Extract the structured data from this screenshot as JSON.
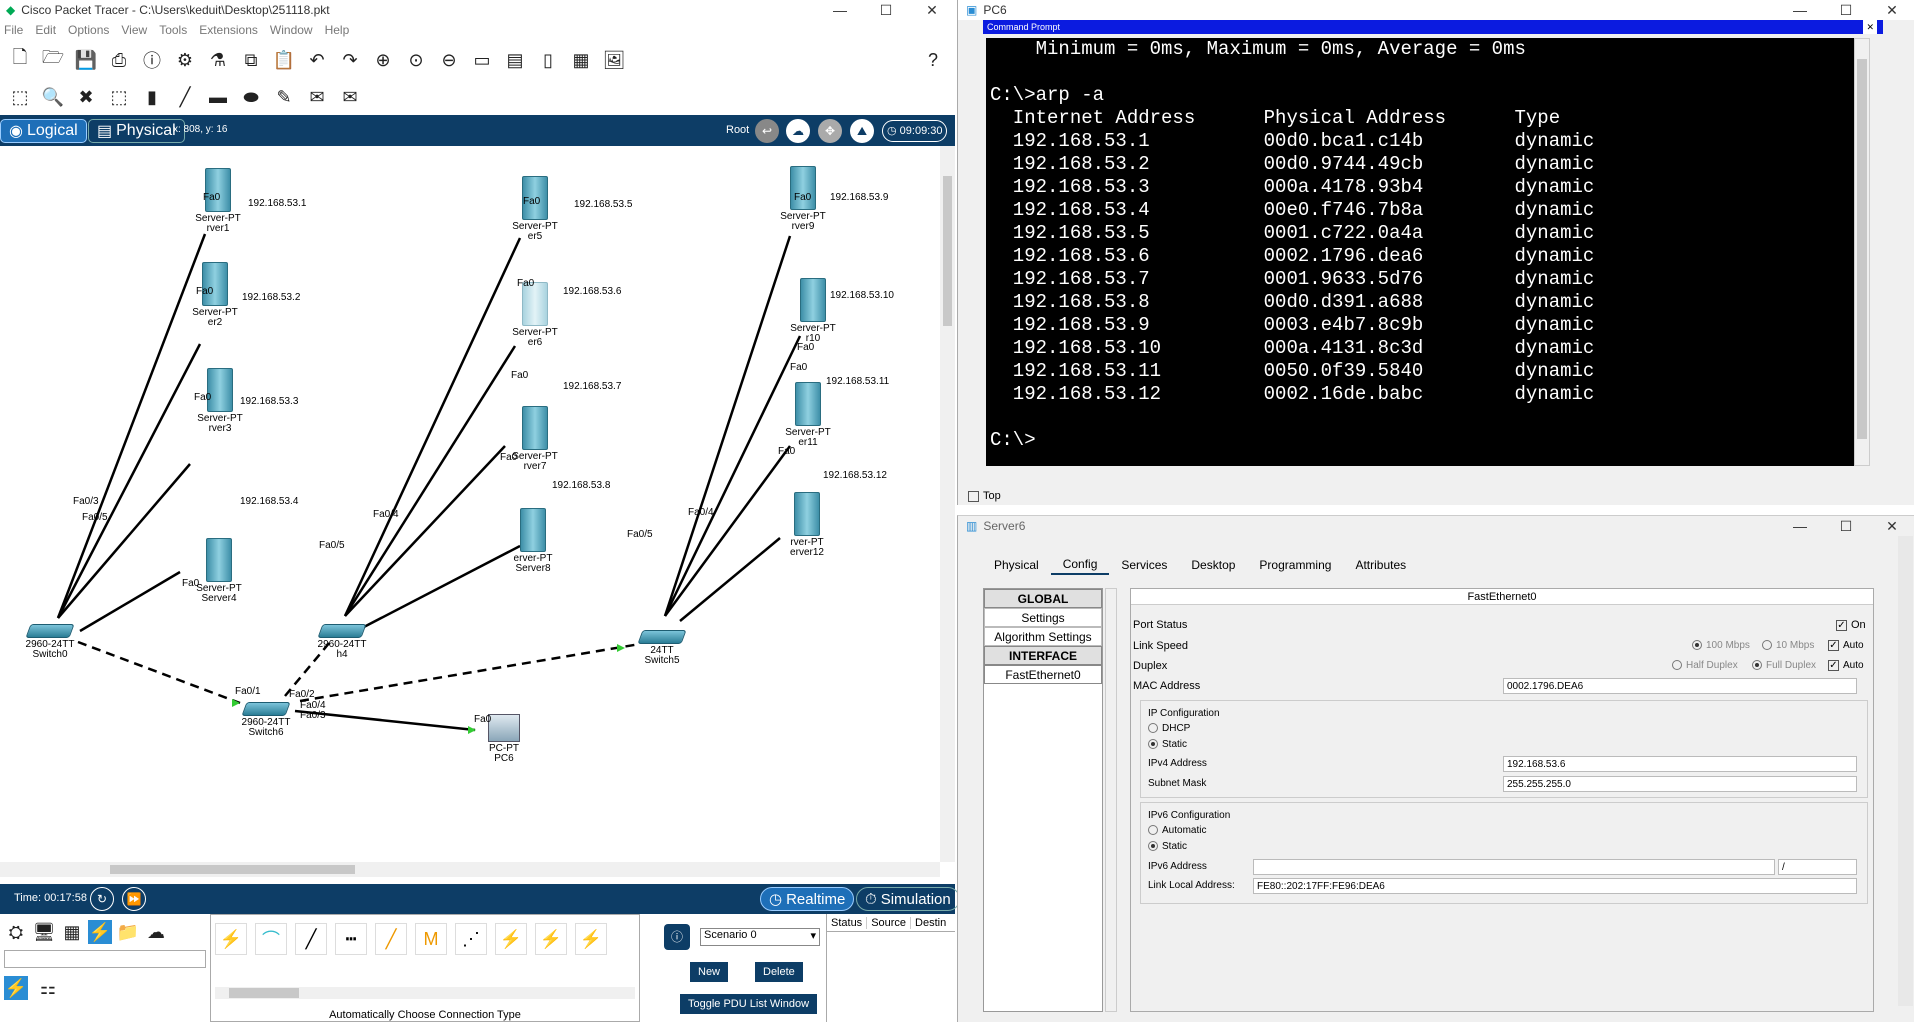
{
  "pt": {
    "title": "Cisco Packet Tracer - C:\\Users\\keduit\\Desktop\\251118.pkt",
    "menu": [
      "File",
      "Edit",
      "Options",
      "View",
      "Tools",
      "Extensions",
      "Window",
      "Help"
    ],
    "logical_label": "Logical",
    "physical_label": "Physical",
    "coords": "x: 808, y: 16",
    "root_label": "Root",
    "clock": "09:09:30",
    "time_label": "Time: 00:17:58",
    "realtime_label": "Realtime",
    "simulation_label": "Simulation",
    "scenario": "Scenario 0",
    "new_label": "New",
    "delete_label": "Delete",
    "toggle_pdu_label": "Toggle PDU List Window",
    "auto_conn_label": "Automatically Choose Connection Type",
    "pdu_cols": [
      "Status",
      "Source",
      "Destin"
    ]
  },
  "devices": {
    "server1": {
      "type": "Server-PT",
      "name": "rver1",
      "port": "Fa0",
      "ip": "192.168.53.1"
    },
    "server2": {
      "type": "Server-PT",
      "name": "er2",
      "port": "Fa0",
      "ip": "192.168.53.2"
    },
    "server3": {
      "type": "Server-PT",
      "name": "rver3",
      "port": "Fa0",
      "ip": "192.168.53.3"
    },
    "server4": {
      "type": "Server-PT",
      "name": "Server4",
      "port": "Fa0",
      "ip": "192.168.53.4"
    },
    "server5": {
      "type": "Server-PT",
      "name": "er5",
      "port": "Fa0",
      "ip": "192.168.53.5"
    },
    "server6": {
      "type": "Server-PT",
      "name": "er6",
      "port": "Fa0",
      "ip": "192.168.53.6"
    },
    "server7": {
      "type": "Server-PT",
      "name": "rver7",
      "port": "Fa0",
      "ip": "192.168.53.7"
    },
    "server8": {
      "type": "erver-PT",
      "name": "Server8",
      "port": "Fa0",
      "ip": "192.168.53.8"
    },
    "server9": {
      "type": "Server-PT",
      "name": "rver9",
      "port": "Fa0",
      "ip": "192.168.53.9"
    },
    "server10": {
      "type": "Server-PT",
      "name": "r10",
      "port": "Fa0",
      "ip": "192.168.53.10"
    },
    "server11": {
      "type": "Server-PT",
      "name": "er11",
      "port": "Fa0",
      "ip": "192.168.53.11"
    },
    "server12": {
      "type": "rver-PT",
      "name": "erver12",
      "port": "Fa0",
      "ip": "192.168.53.12"
    },
    "switch0": {
      "type": "2960-24TT",
      "name": "Switch0",
      "ports": [
        "Fa0/3",
        "Fa0/5"
      ]
    },
    "switch4": {
      "type": "2960-24TT",
      "name": "h4",
      "ports": [
        "Fa0/4",
        "Fa0/5"
      ]
    },
    "switch5": {
      "type": "24TT",
      "name": "Switch5",
      "ports": [
        "Fa0/5",
        "Fa0/4"
      ]
    },
    "switch6": {
      "type": "2960-24TT",
      "name": "Switch6",
      "ports": [
        "Fa0/1",
        "Fa0/2",
        "Fa0/4",
        "Fa0/3"
      ]
    },
    "pc6": {
      "type": "PC-PT",
      "name": "PC6",
      "port": "Fa0"
    }
  },
  "cmd": {
    "title": "PC6",
    "subtitle": "Command Prompt",
    "lines": [
      "    Minimum = 0ms, Maximum = 0ms, Average = 0ms",
      "",
      "C:\\>arp -a",
      "  Internet Address      Physical Address      Type",
      "  192.168.53.1          00d0.bca1.c14b        dynamic",
      "  192.168.53.2          00d0.9744.49cb        dynamic",
      "  192.168.53.3          000a.4178.93b4        dynamic",
      "  192.168.53.4          00e0.f746.7b8a        dynamic",
      "  192.168.53.5          0001.c722.0a4a        dynamic",
      "  192.168.53.6          0002.1796.dea6        dynamic",
      "  192.168.53.7          0001.9633.5d76        dynamic",
      "  192.168.53.8          00d0.d391.a688        dynamic",
      "  192.168.53.9          0003.e4b7.8c9b        dynamic",
      "  192.168.53.10         000a.4131.8c3d        dynamic",
      "  192.168.53.11         0050.0f39.5840        dynamic",
      "  192.168.53.12         0002.16de.babc        dynamic",
      "",
      "C:\\>"
    ],
    "top_label": "Top"
  },
  "server6": {
    "title": "Server6",
    "tabs": [
      "Physical",
      "Config",
      "Services",
      "Desktop",
      "Programming",
      "Attributes"
    ],
    "nav": {
      "global": "GLOBAL",
      "settings": "Settings",
      "algorithm": "Algorithm Settings",
      "interface": "INTERFACE",
      "fe0": "FastEthernet0"
    },
    "panel_title": "FastEthernet0",
    "port_status": "Port Status",
    "on": "On",
    "link_speed": "Link Speed",
    "s100": "100 Mbps",
    "s10": "10 Mbps",
    "auto": "Auto",
    "duplex": "Duplex",
    "half": "Half Duplex",
    "full": "Full Duplex",
    "mac_label": "MAC Address",
    "mac": "0002.1796.DEA6",
    "ipconf": "IP Configuration",
    "dhcp": "DHCP",
    "static": "Static",
    "ipv4_label": "IPv4 Address",
    "ipv4": "192.168.53.6",
    "mask_label": "Subnet Mask",
    "mask": "255.255.255.0",
    "ipv6conf": "IPv6 Configuration",
    "automatic": "Automatic",
    "ipv6_label": "IPv6 Address",
    "ipv6": "",
    "prefix": "/",
    "lla_label": "Link Local Address:",
    "lla": "FE80::202:17FF:FE96:DEA6"
  }
}
